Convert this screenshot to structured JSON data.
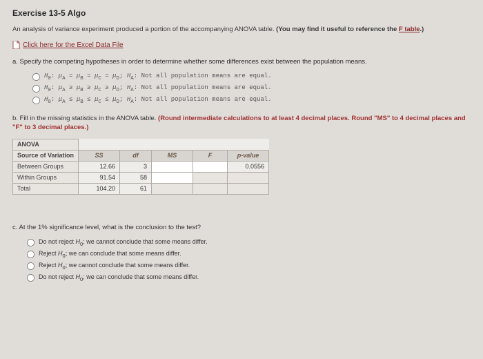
{
  "title": "Exercise 13-5 Algo",
  "intro_a": "An analysis of variance experiment produced a portion of the accompanying ANOVA table. ",
  "intro_b": "(You may find it useful to reference the ",
  "intro_link": "F table",
  "intro_c": ".)",
  "excel_link": "Click here for the Excel Data File",
  "part_a": "a. Specify the competing hypotheses in order to determine whether some differences exist between the population means.",
  "opt1_pre": "H0: μA = μB = μC = μD; HA: Not all population means are equal.",
  "opt2_pre": "H0: μA ≥ μB ≥ μC ≥ μD; HA: Not all population means are equal.",
  "opt3_pre": "H0: μA ≤ μB ≤ μC ≤ μD; HA: Not all population means are equal.",
  "part_b_a": "b. Fill in the missing statistics in the ANOVA table. ",
  "part_b_b": "(Round intermediate calculations to at least 4 decimal places. Round \"MS\" to 4 decimal places and \"F\" to 3 decimal places.)",
  "table": {
    "hdr_anova": "ANOVA",
    "hdr_source": "Source of Variation",
    "hdr_ss": "SS",
    "hdr_df": "df",
    "hdr_ms": "MS",
    "hdr_f": "F",
    "hdr_p": "p-value",
    "r1_label": "Between Groups",
    "r1_ss": "12.66",
    "r1_df": "3",
    "r1_p": "0.0556",
    "r2_label": "Within Groups",
    "r2_ss": "91.54",
    "r2_df": "58",
    "r3_label": "Total",
    "r3_ss": "104.20",
    "r3_df": "61"
  },
  "part_c": "c. At the 1% significance level, what is the conclusion to the test?",
  "c1": "Do not reject H0; we cannot conclude that some means differ.",
  "c2": "Reject H0; we can conclude that some means differ.",
  "c3": "Reject H0; we cannot conclude that some means differ.",
  "c4": "Do not reject H0; we can conclude that some means differ."
}
